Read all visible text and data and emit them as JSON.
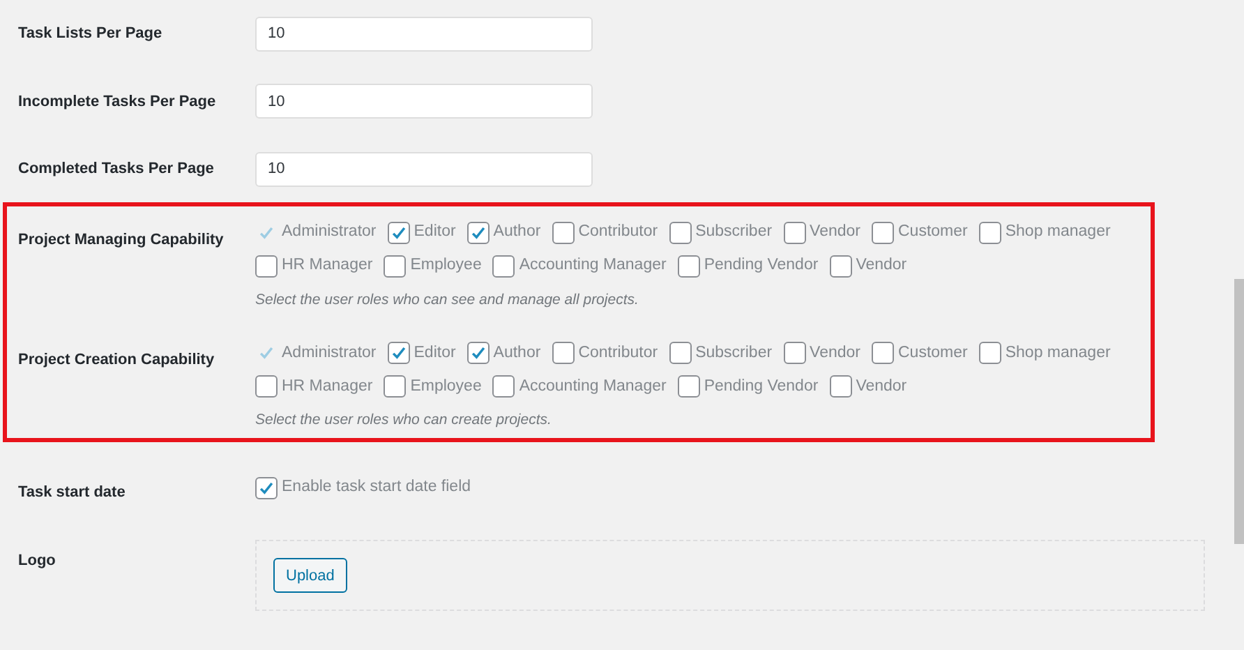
{
  "number_settings": [
    {
      "label": "Task Lists Per Page",
      "value": "10"
    },
    {
      "label": "Incomplete Tasks Per Page",
      "value": "10"
    },
    {
      "label": "Completed Tasks Per Page",
      "value": "10"
    }
  ],
  "capabilities": {
    "highlighted": true,
    "items": [
      {
        "label": "Project Managing Capability",
        "description": "Select the user roles who can see and manage all projects.",
        "roles": [
          {
            "label": "Administrator",
            "checked": true,
            "disabled": true
          },
          {
            "label": "Editor",
            "checked": true,
            "disabled": false
          },
          {
            "label": "Author",
            "checked": true,
            "disabled": false
          },
          {
            "label": "Contributor",
            "checked": false,
            "disabled": false
          },
          {
            "label": "Subscriber",
            "checked": false,
            "disabled": false
          },
          {
            "label": "Vendor",
            "checked": false,
            "disabled": false
          },
          {
            "label": "Customer",
            "checked": false,
            "disabled": false
          },
          {
            "label": "Shop manager",
            "checked": false,
            "disabled": false
          },
          {
            "label": "HR Manager",
            "checked": false,
            "disabled": false
          },
          {
            "label": "Employee",
            "checked": false,
            "disabled": false
          },
          {
            "label": "Accounting Manager",
            "checked": false,
            "disabled": false
          },
          {
            "label": "Pending Vendor",
            "checked": false,
            "disabled": false
          },
          {
            "label": "Vendor",
            "checked": false,
            "disabled": false
          }
        ]
      },
      {
        "label": "Project Creation Capability",
        "description": "Select the user roles who can create projects.",
        "roles": [
          {
            "label": "Administrator",
            "checked": true,
            "disabled": true
          },
          {
            "label": "Editor",
            "checked": true,
            "disabled": false
          },
          {
            "label": "Author",
            "checked": true,
            "disabled": false
          },
          {
            "label": "Contributor",
            "checked": false,
            "disabled": false
          },
          {
            "label": "Subscriber",
            "checked": false,
            "disabled": false
          },
          {
            "label": "Vendor",
            "checked": false,
            "disabled": false
          },
          {
            "label": "Customer",
            "checked": false,
            "disabled": false
          },
          {
            "label": "Shop manager",
            "checked": false,
            "disabled": false
          },
          {
            "label": "HR Manager",
            "checked": false,
            "disabled": false
          },
          {
            "label": "Employee",
            "checked": false,
            "disabled": false
          },
          {
            "label": "Accounting Manager",
            "checked": false,
            "disabled": false
          },
          {
            "label": "Pending Vendor",
            "checked": false,
            "disabled": false
          },
          {
            "label": "Vendor",
            "checked": false,
            "disabled": false
          }
        ]
      }
    ]
  },
  "task_start_date": {
    "label": "Task start date",
    "option": "Enable task start date field",
    "checked": true
  },
  "logo": {
    "label": "Logo",
    "button": "Upload"
  }
}
